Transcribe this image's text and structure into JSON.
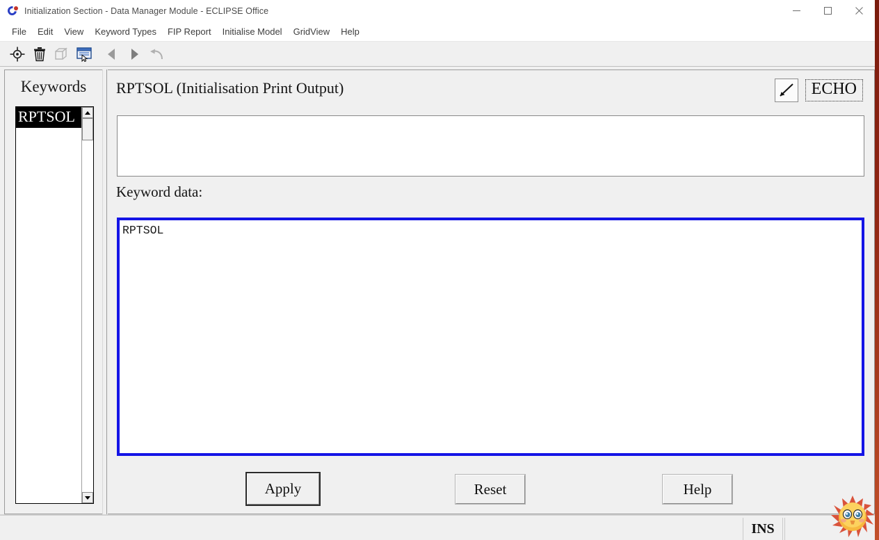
{
  "window": {
    "title": "Initialization Section - Data Manager Module - ECLIPSE Office",
    "icon": "eclipse-office-logo",
    "controls": {
      "minimize": "minimize-icon",
      "maximize": "maximize-icon",
      "close": "close-icon"
    }
  },
  "menubar": {
    "items": [
      {
        "label": "File"
      },
      {
        "label": "Edit"
      },
      {
        "label": "View"
      },
      {
        "label": "Keyword Types"
      },
      {
        "label": "FIP Report"
      },
      {
        "label": "Initialise Model"
      },
      {
        "label": "GridView"
      },
      {
        "label": "Help"
      }
    ]
  },
  "toolbar": {
    "buttons": [
      {
        "name": "target-crosshair-icon",
        "enabled": true
      },
      {
        "name": "trash-delete-icon",
        "enabled": true
      },
      {
        "name": "box-3d-icon",
        "enabled": false
      },
      {
        "name": "window-preview-icon",
        "enabled": true
      },
      {
        "name": "back-triangle-icon",
        "enabled": true
      },
      {
        "name": "forward-triangle-icon",
        "enabled": true
      },
      {
        "name": "undo-arrow-icon",
        "enabled": false
      }
    ]
  },
  "sidebar": {
    "title": "Keywords",
    "items": [
      {
        "label": "RPTSOL",
        "selected": true
      }
    ],
    "scrollbar": {
      "up_arrow": "scroll-up-arrow-icon",
      "down_arrow": "scroll-down-arrow-icon"
    }
  },
  "main": {
    "keyword_title": "RPTSOL (Initialisation Print Output)",
    "echo": {
      "checkbox_icon": "checkmark-icon",
      "label": "ECHO",
      "checked": true
    },
    "description_input": {
      "value": "",
      "placeholder": ""
    },
    "keyword_data_label": "Keyword data:",
    "keyword_data_value": "RPTSOL",
    "buttons": {
      "apply": "Apply",
      "reset": "Reset",
      "help": "Help"
    }
  },
  "statusbar": {
    "message": "",
    "insert_mode": "INS",
    "overlay_icon": "sun-emoji"
  },
  "colors": {
    "window_bg": "#f0f0f0",
    "panel_border": "#9b9b9b",
    "data_border_blue": "#1414e6",
    "selection_bg": "#000000",
    "selection_fg": "#ffffff",
    "frame_accent": "#8d2412"
  }
}
